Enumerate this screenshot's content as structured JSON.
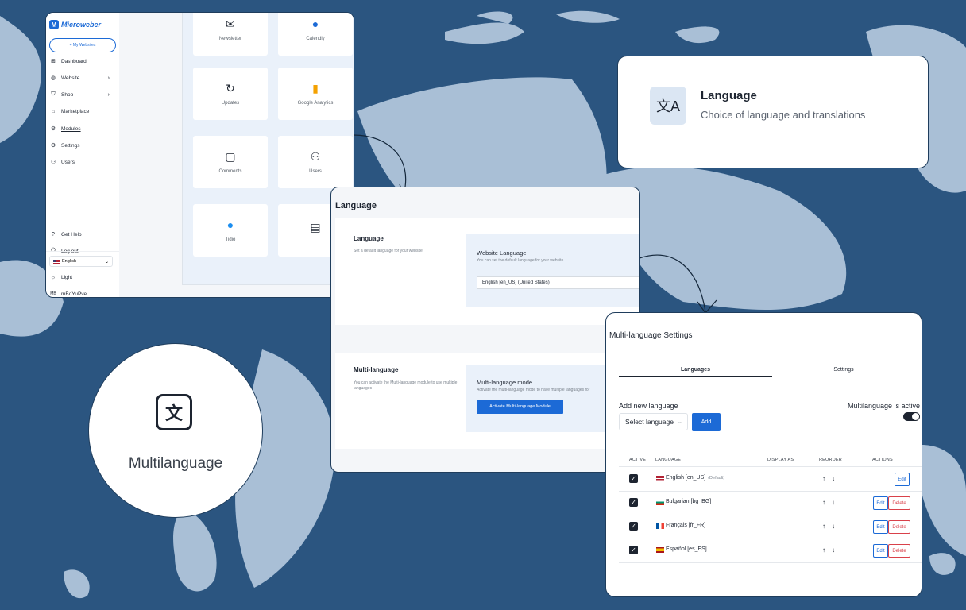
{
  "admin": {
    "brand": "Microweber",
    "my_websites": "+ My Websites",
    "nav": [
      {
        "label": "Dashboard",
        "icon": "dashboard-icon",
        "glyph": "⊞"
      },
      {
        "label": "Website",
        "icon": "globe-icon",
        "glyph": "◍"
      },
      {
        "label": "Shop",
        "icon": "shop-icon",
        "glyph": "⛉"
      },
      {
        "label": "Marketplace",
        "icon": "store-icon",
        "glyph": "⌂"
      },
      {
        "label": "Modules",
        "icon": "modules-icon",
        "glyph": "⚙"
      },
      {
        "label": "Settings",
        "icon": "settings-icon",
        "glyph": "⚙"
      },
      {
        "label": "Users",
        "icon": "users-icon",
        "glyph": "⚇"
      }
    ],
    "get_help": "Get Help",
    "log_out": "Log out",
    "language": "English",
    "theme": "Light",
    "user_initials": "MB",
    "user_name": "mBoYuPve",
    "tiles": [
      {
        "label": "Newsletter",
        "icon": "newsletter-icon"
      },
      {
        "label": "Calendly",
        "icon": "calendly-icon"
      },
      {
        "label": "Updates",
        "icon": "refresh-icon"
      },
      {
        "label": "Google Analytics",
        "icon": "analytics-icon"
      },
      {
        "label": "Comments",
        "icon": "comment-icon"
      },
      {
        "label": "Users",
        "icon": "users-icon"
      },
      {
        "label": "Tidio",
        "icon": "tidio-icon"
      },
      {
        "label": "",
        "icon": "module-icon"
      }
    ]
  },
  "feature": {
    "title": "Language",
    "subtitle": "Choice of language and translations"
  },
  "language_page": {
    "heading": "Language",
    "language_section": {
      "title": "Language",
      "description": "Set a default language for your website",
      "box_title": "Website Language",
      "box_desc": "You can set the default language for your website.",
      "selected": "English [en_US] (United States)"
    },
    "multi_section": {
      "title": "Multi-language",
      "description": "You can activate the Multi-language module to use multiple languages",
      "box_title": "Multi-language mode",
      "box_desc": "Activate the multi-language mode to have multiple languages for",
      "button": "Activate Multi-language Module"
    }
  },
  "multi": {
    "heading": "Multi-language Settings",
    "tabs": [
      "Languages",
      "Settings"
    ],
    "add_label": "Add new language",
    "select_placeholder": "Select language",
    "add_button": "Add",
    "active_label": "Multilanguage is active",
    "columns": [
      "ACTIVE",
      "LANGUAGE",
      "DISPLAY AS",
      "REORDER",
      "ACTIONS"
    ],
    "rows": [
      {
        "name": "English [en_US]",
        "default": "(Default)",
        "flag": "us",
        "edit": "Edit",
        "delete": ""
      },
      {
        "name": "Bulgarian [bg_BG]",
        "default": "",
        "flag": "bg",
        "edit": "Edit",
        "delete": "Delete"
      },
      {
        "name": "Français [fr_FR]",
        "default": "",
        "flag": "fr",
        "edit": "Edit",
        "delete": "Delete"
      },
      {
        "name": "Español [es_ES]",
        "default": "",
        "flag": "es",
        "edit": "Edit",
        "delete": "Delete"
      }
    ]
  },
  "badge": {
    "label": "Multilanguage"
  },
  "colors": {
    "background": "#2b5580",
    "land": "#a9bfd6",
    "accent": "#1c6ad6",
    "danger": "#d9414a"
  }
}
